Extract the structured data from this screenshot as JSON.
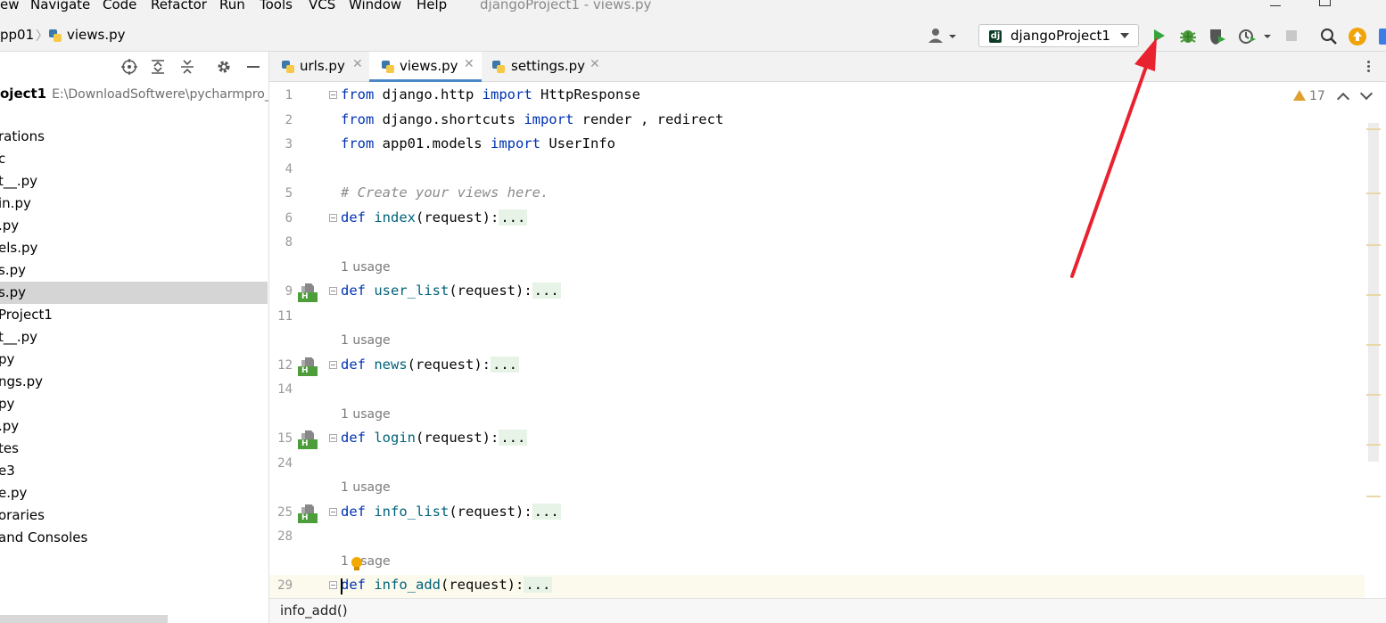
{
  "menu": {
    "items": [
      "ew",
      "Navigate",
      "Code",
      "Refactor",
      "Run",
      "Tools",
      "VCS",
      "Window",
      "Help"
    ],
    "window_title": "djangoProject1 - views.py"
  },
  "nav": {
    "breadcrumb_parent": "pp01",
    "breadcrumb_file": "views.py",
    "run_config": "djangoProject1"
  },
  "project": {
    "root_name": "oject1",
    "root_path": "E:\\DownloadSoftwere\\pycharmpro_",
    "items": [
      {
        "label": "rations",
        "selected": false
      },
      {
        "label": "c",
        "selected": false
      },
      {
        "label": "t__.py",
        "selected": false
      },
      {
        "label": "in.py",
        "selected": false
      },
      {
        "label": ".py",
        "selected": false
      },
      {
        "label": "els.py",
        "selected": false
      },
      {
        "label": "s.py",
        "selected": false
      },
      {
        "label": "s.py",
        "selected": true
      },
      {
        "label": "Project1",
        "selected": false
      },
      {
        "label": "t__.py",
        "selected": false
      },
      {
        "label": "py",
        "selected": false
      },
      {
        "label": "ngs.py",
        "selected": false
      },
      {
        "label": "py",
        "selected": false
      },
      {
        "label": ".py",
        "selected": false
      },
      {
        "label": "tes",
        "selected": false
      },
      {
        "label": "e3",
        "selected": false
      },
      {
        "label": "e.py",
        "selected": false
      },
      {
        "label": "oraries",
        "selected": false
      },
      {
        "label": "and Consoles",
        "selected": false
      }
    ]
  },
  "tabs": [
    {
      "label": "urls.py",
      "active": false
    },
    {
      "label": "views.py",
      "active": true
    },
    {
      "label": "settings.py",
      "active": false
    }
  ],
  "editor": {
    "warning_count": "17",
    "usage_label": "1 usage",
    "lines": [
      {
        "num": "1",
        "kind": "import",
        "parts": [
          "from",
          " django.http ",
          "import",
          " HttpResponse"
        ]
      },
      {
        "num": "2",
        "kind": "import",
        "parts": [
          "from",
          " django.shortcuts ",
          "import",
          " render , redirect"
        ]
      },
      {
        "num": "3",
        "kind": "import",
        "parts": [
          "from",
          " app01.models ",
          "import",
          " UserInfo"
        ]
      },
      {
        "num": "4",
        "kind": "blank"
      },
      {
        "num": "5",
        "kind": "comment",
        "text": "# Create your views here."
      },
      {
        "num": "6",
        "kind": "def",
        "name": "index",
        "args": "(request):",
        "dots": "..."
      },
      {
        "num": "8",
        "kind": "blank"
      },
      {
        "num": "9",
        "kind": "def",
        "name": "user_list",
        "args": "(request):",
        "dots": "...",
        "usage": true
      },
      {
        "num": "11",
        "kind": "blank"
      },
      {
        "num": "12",
        "kind": "def",
        "name": "news",
        "args": "(request):",
        "dots": "...",
        "usage": true
      },
      {
        "num": "14",
        "kind": "blank"
      },
      {
        "num": "15",
        "kind": "def",
        "name": "login",
        "args": "(request):",
        "dots": "...",
        "usage": true
      },
      {
        "num": "24",
        "kind": "blank"
      },
      {
        "num": "25",
        "kind": "def",
        "name": "info_list",
        "args": "(request):",
        "dots": "...",
        "usage": true
      },
      {
        "num": "28",
        "kind": "blank"
      },
      {
        "num": "29",
        "kind": "def",
        "name": "info_add",
        "args": "(request):",
        "dots": "...",
        "usage": true,
        "current": true
      }
    ],
    "def_keyword": "def"
  },
  "status": {
    "breadcrumb": "info_add()"
  },
  "colors": {
    "keyword": "#0033b3",
    "function": "#00627a",
    "comment": "#8c8c8c",
    "run_green": "#36a43c",
    "annotation_red": "#e8222e"
  }
}
